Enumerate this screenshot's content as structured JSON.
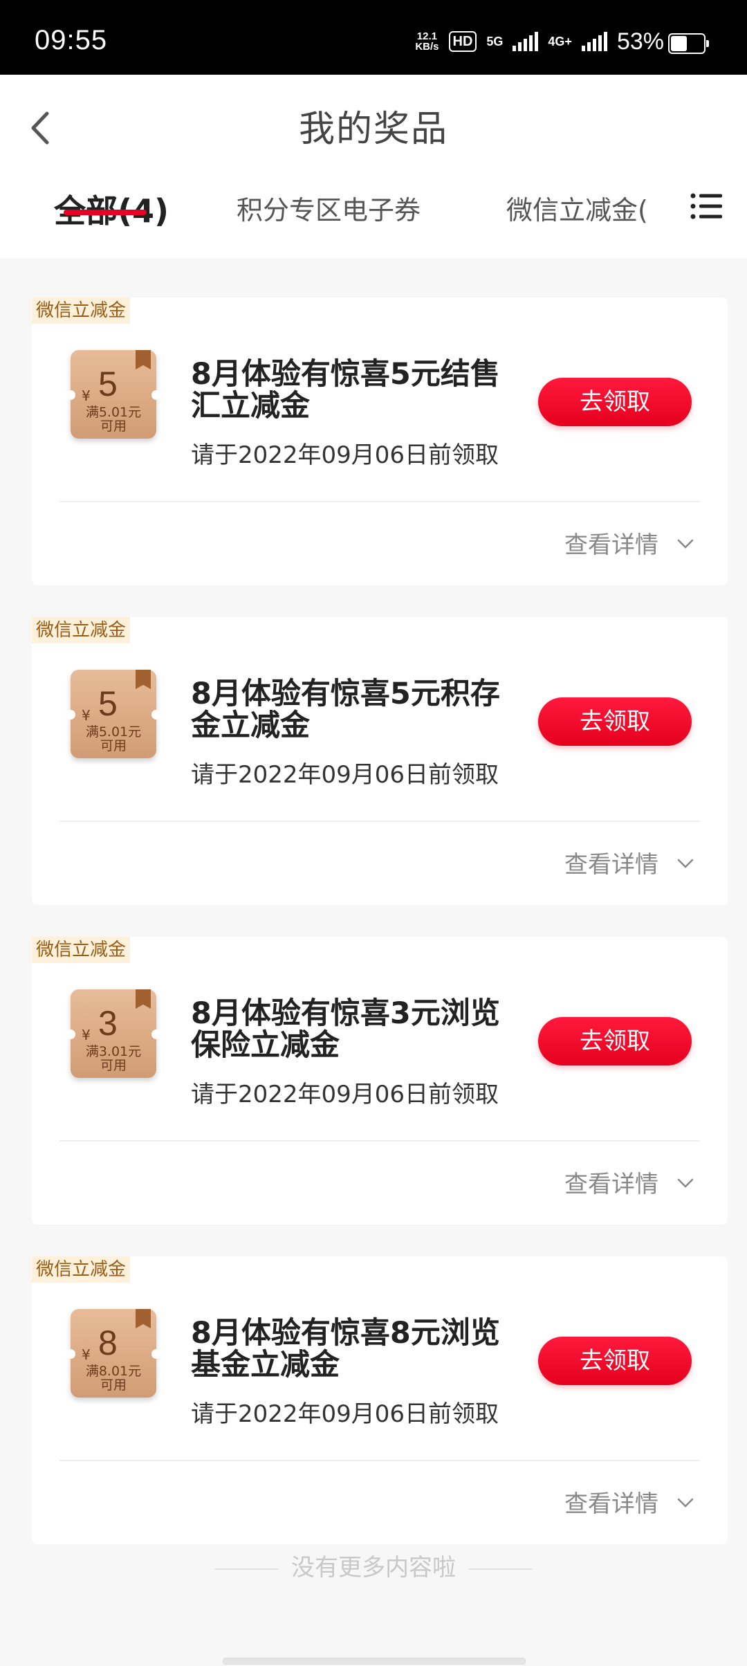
{
  "status_bar": {
    "time": "09:55",
    "net_speed_value": "12.1",
    "net_speed_unit": "KB/s",
    "hd_label": "HD",
    "net_5g": "5G",
    "net_4g": "4G+",
    "battery_text": "53%",
    "battery_level": 0.53
  },
  "header": {
    "title": "我的奖品",
    "tabs": [
      {
        "label": "全部(4)",
        "active": true
      },
      {
        "label": "积分专区电子券",
        "active": false
      },
      {
        "label": "微信立减金(",
        "active": false
      }
    ]
  },
  "colors": {
    "accent": "#e60026",
    "tag_bg": "#fdf1dc",
    "tag_text": "#9a5b12"
  },
  "icons": {
    "back": "chevron-left-icon",
    "menu": "list-menu-icon",
    "expand": "chevron-down-icon"
  },
  "prizes": [
    {
      "tag": "微信立减金",
      "coupon_currency": "¥",
      "coupon_amount": "5",
      "coupon_condition": "满5.01元",
      "coupon_usable": "可用",
      "title": "8月体验有惊喜5元结售汇立减金",
      "deadline": "请于2022年09月06日前领取",
      "button": "去领取",
      "detail": "查看详情"
    },
    {
      "tag": "微信立减金",
      "coupon_currency": "¥",
      "coupon_amount": "5",
      "coupon_condition": "满5.01元",
      "coupon_usable": "可用",
      "title": "8月体验有惊喜5元积存金立减金",
      "deadline": "请于2022年09月06日前领取",
      "button": "去领取",
      "detail": "查看详情"
    },
    {
      "tag": "微信立减金",
      "coupon_currency": "¥",
      "coupon_amount": "3",
      "coupon_condition": "满3.01元",
      "coupon_usable": "可用",
      "title": "8月体验有惊喜3元浏览保险立减金",
      "deadline": "请于2022年09月06日前领取",
      "button": "去领取",
      "detail": "查看详情"
    },
    {
      "tag": "微信立减金",
      "coupon_currency": "¥",
      "coupon_amount": "8",
      "coupon_condition": "满8.01元",
      "coupon_usable": "可用",
      "title": "8月体验有惊喜8元浏览基金立减金",
      "deadline": "请于2022年09月06日前领取",
      "button": "去领取",
      "detail": "查看详情"
    }
  ],
  "footer": {
    "end_text": "没有更多内容啦"
  }
}
